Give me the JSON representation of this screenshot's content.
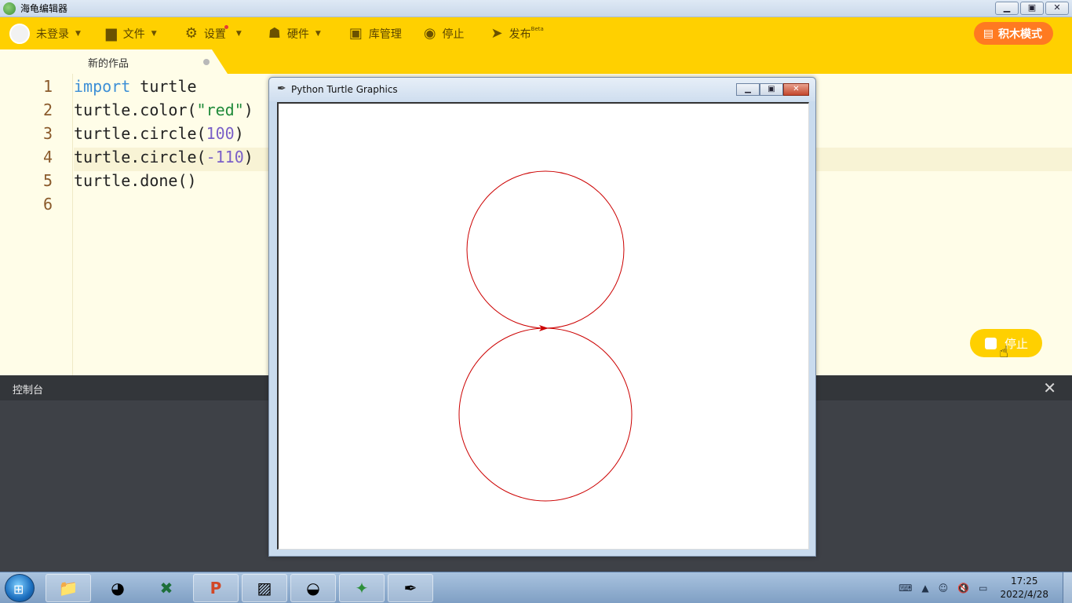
{
  "window": {
    "title": "海龟编辑器"
  },
  "window_controls": {
    "minimize": "▁",
    "maximize": "▣",
    "close": "✕"
  },
  "toolbar": {
    "login": "未登录",
    "file": "文件",
    "settings": "设置",
    "hardware": "硬件",
    "library": "库管理",
    "stop": "停止",
    "publish": "发布",
    "publish_badge": "Beta",
    "block_mode": "积木模式"
  },
  "tab": {
    "title": "新的作品"
  },
  "editor": {
    "line_numbers": [
      "1",
      "2",
      "3",
      "4",
      "5",
      "6"
    ],
    "lines": [
      [
        {
          "t": "import",
          "c": "kw"
        },
        {
          "t": " turtle",
          "c": ""
        }
      ],
      [
        {
          "t": "turtle.color(",
          "c": ""
        },
        {
          "t": "\"red\"",
          "c": "str"
        },
        {
          "t": ")",
          "c": ""
        }
      ],
      [
        {
          "t": "turtle.circle(",
          "c": ""
        },
        {
          "t": "100",
          "c": "num"
        },
        {
          "t": ")",
          "c": ""
        }
      ],
      [
        {
          "t": "turtle.circle(",
          "c": ""
        },
        {
          "t": "-110",
          "c": "num"
        },
        {
          "t": ")",
          "c": ""
        }
      ],
      [
        {
          "t": "turtle.done()",
          "c": ""
        }
      ],
      []
    ],
    "active_line": 4
  },
  "float_stop": {
    "label": "停止"
  },
  "console": {
    "title": "控制台",
    "close": "✕"
  },
  "turtle_window": {
    "title": "Python Turtle Graphics",
    "pen_color": "#cc0000",
    "circles": [
      100,
      -110
    ]
  },
  "taskbar": {
    "items": [
      "folder-icon",
      "firefox-icon",
      "excel-icon",
      "powerpoint-icon",
      "photos-icon",
      "owl-icon",
      "turtle-editor-icon",
      "python-feather-icon"
    ],
    "time": "17:25",
    "date": "2022/4/28"
  },
  "colors": {
    "toolbar": "#ffd000",
    "block_mode": "#ff7a21",
    "console": "#3e4147"
  }
}
